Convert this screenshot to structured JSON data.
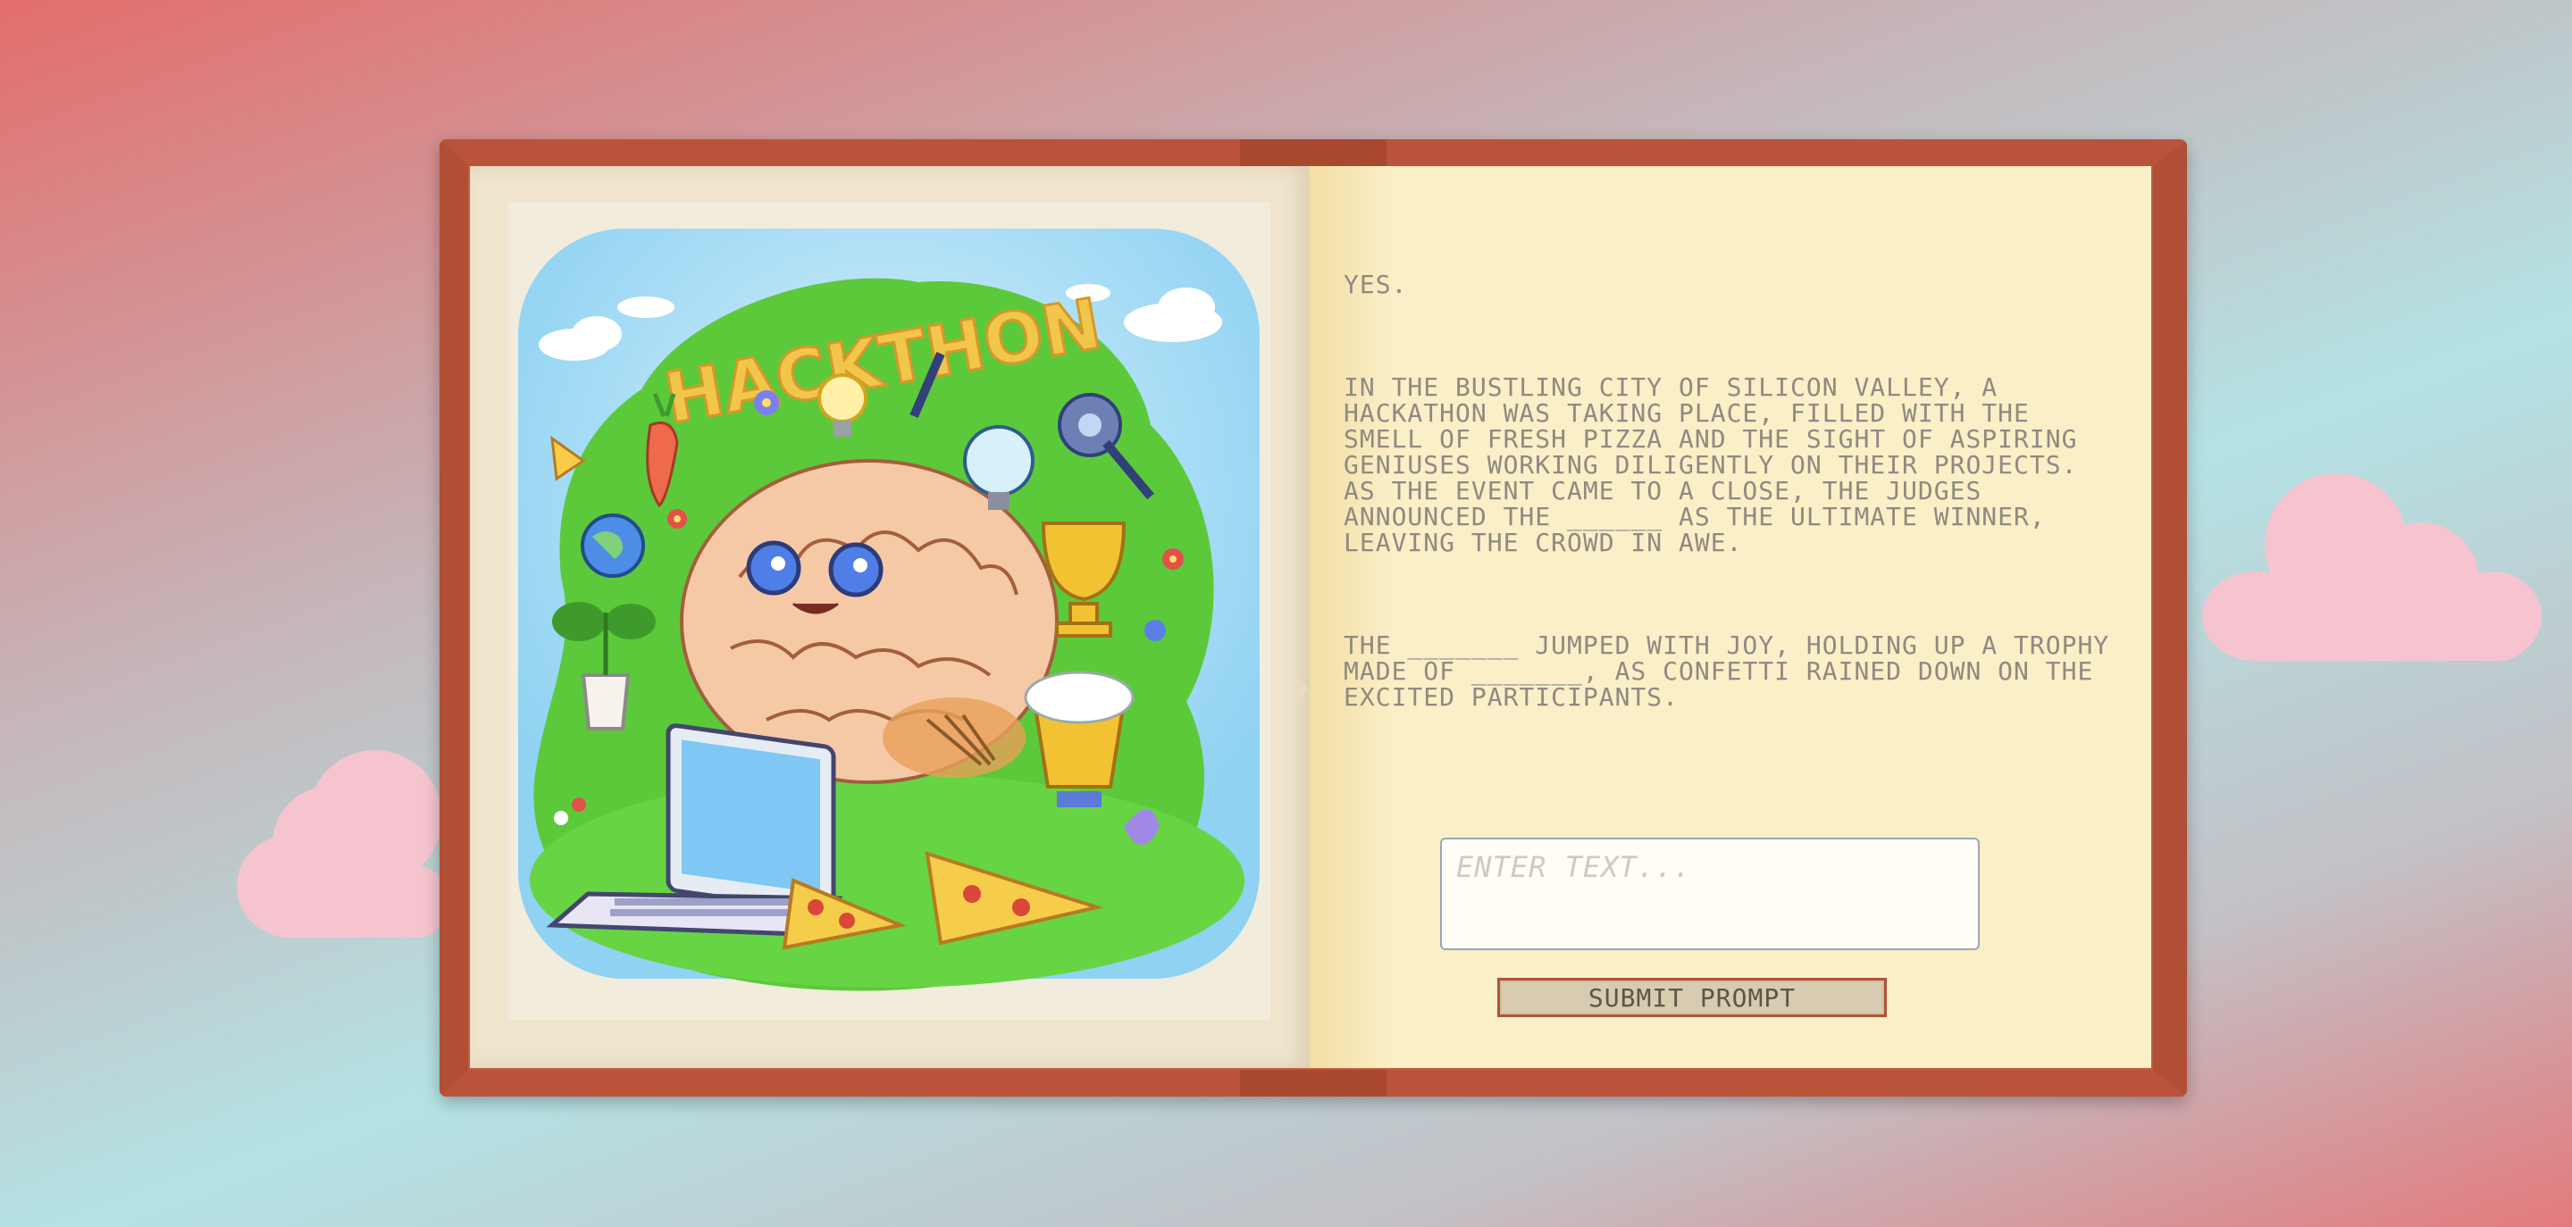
{
  "story": {
    "line1": "YES.",
    "paragraph1": "IN THE BUSTLING CITY OF SILICON VALLEY, A HACKATHON WAS TAKING PLACE, FILLED WITH THE SMELL OF FRESH PIZZA AND THE SIGHT OF ASPIRING GENIUSES WORKING DILIGENTLY ON THEIR PROJECTS. AS THE EVENT CAME TO A CLOSE, THE JUDGES ANNOUNCED THE ______ AS THE ULTIMATE WINNER, LEAVING THE CROWD IN AWE.",
    "paragraph2": "THE _______ JUMPED WITH JOY, HOLDING UP A TROPHY MADE OF _______, AS CONFETTI RAINED DOWN ON THE EXCITED PARTICIPANTS."
  },
  "illustration": {
    "banner_text": "HACKTHON"
  },
  "input": {
    "placeholder": "ENTER TEXT..."
  },
  "submit": {
    "label": "SUBMIT PROMPT"
  },
  "colors": {
    "book_cover": "#c25c42",
    "page": "#fbefc8",
    "cloud": "#f5c4cf",
    "grass": "#5cc93a",
    "sky": "#a8dff5"
  }
}
